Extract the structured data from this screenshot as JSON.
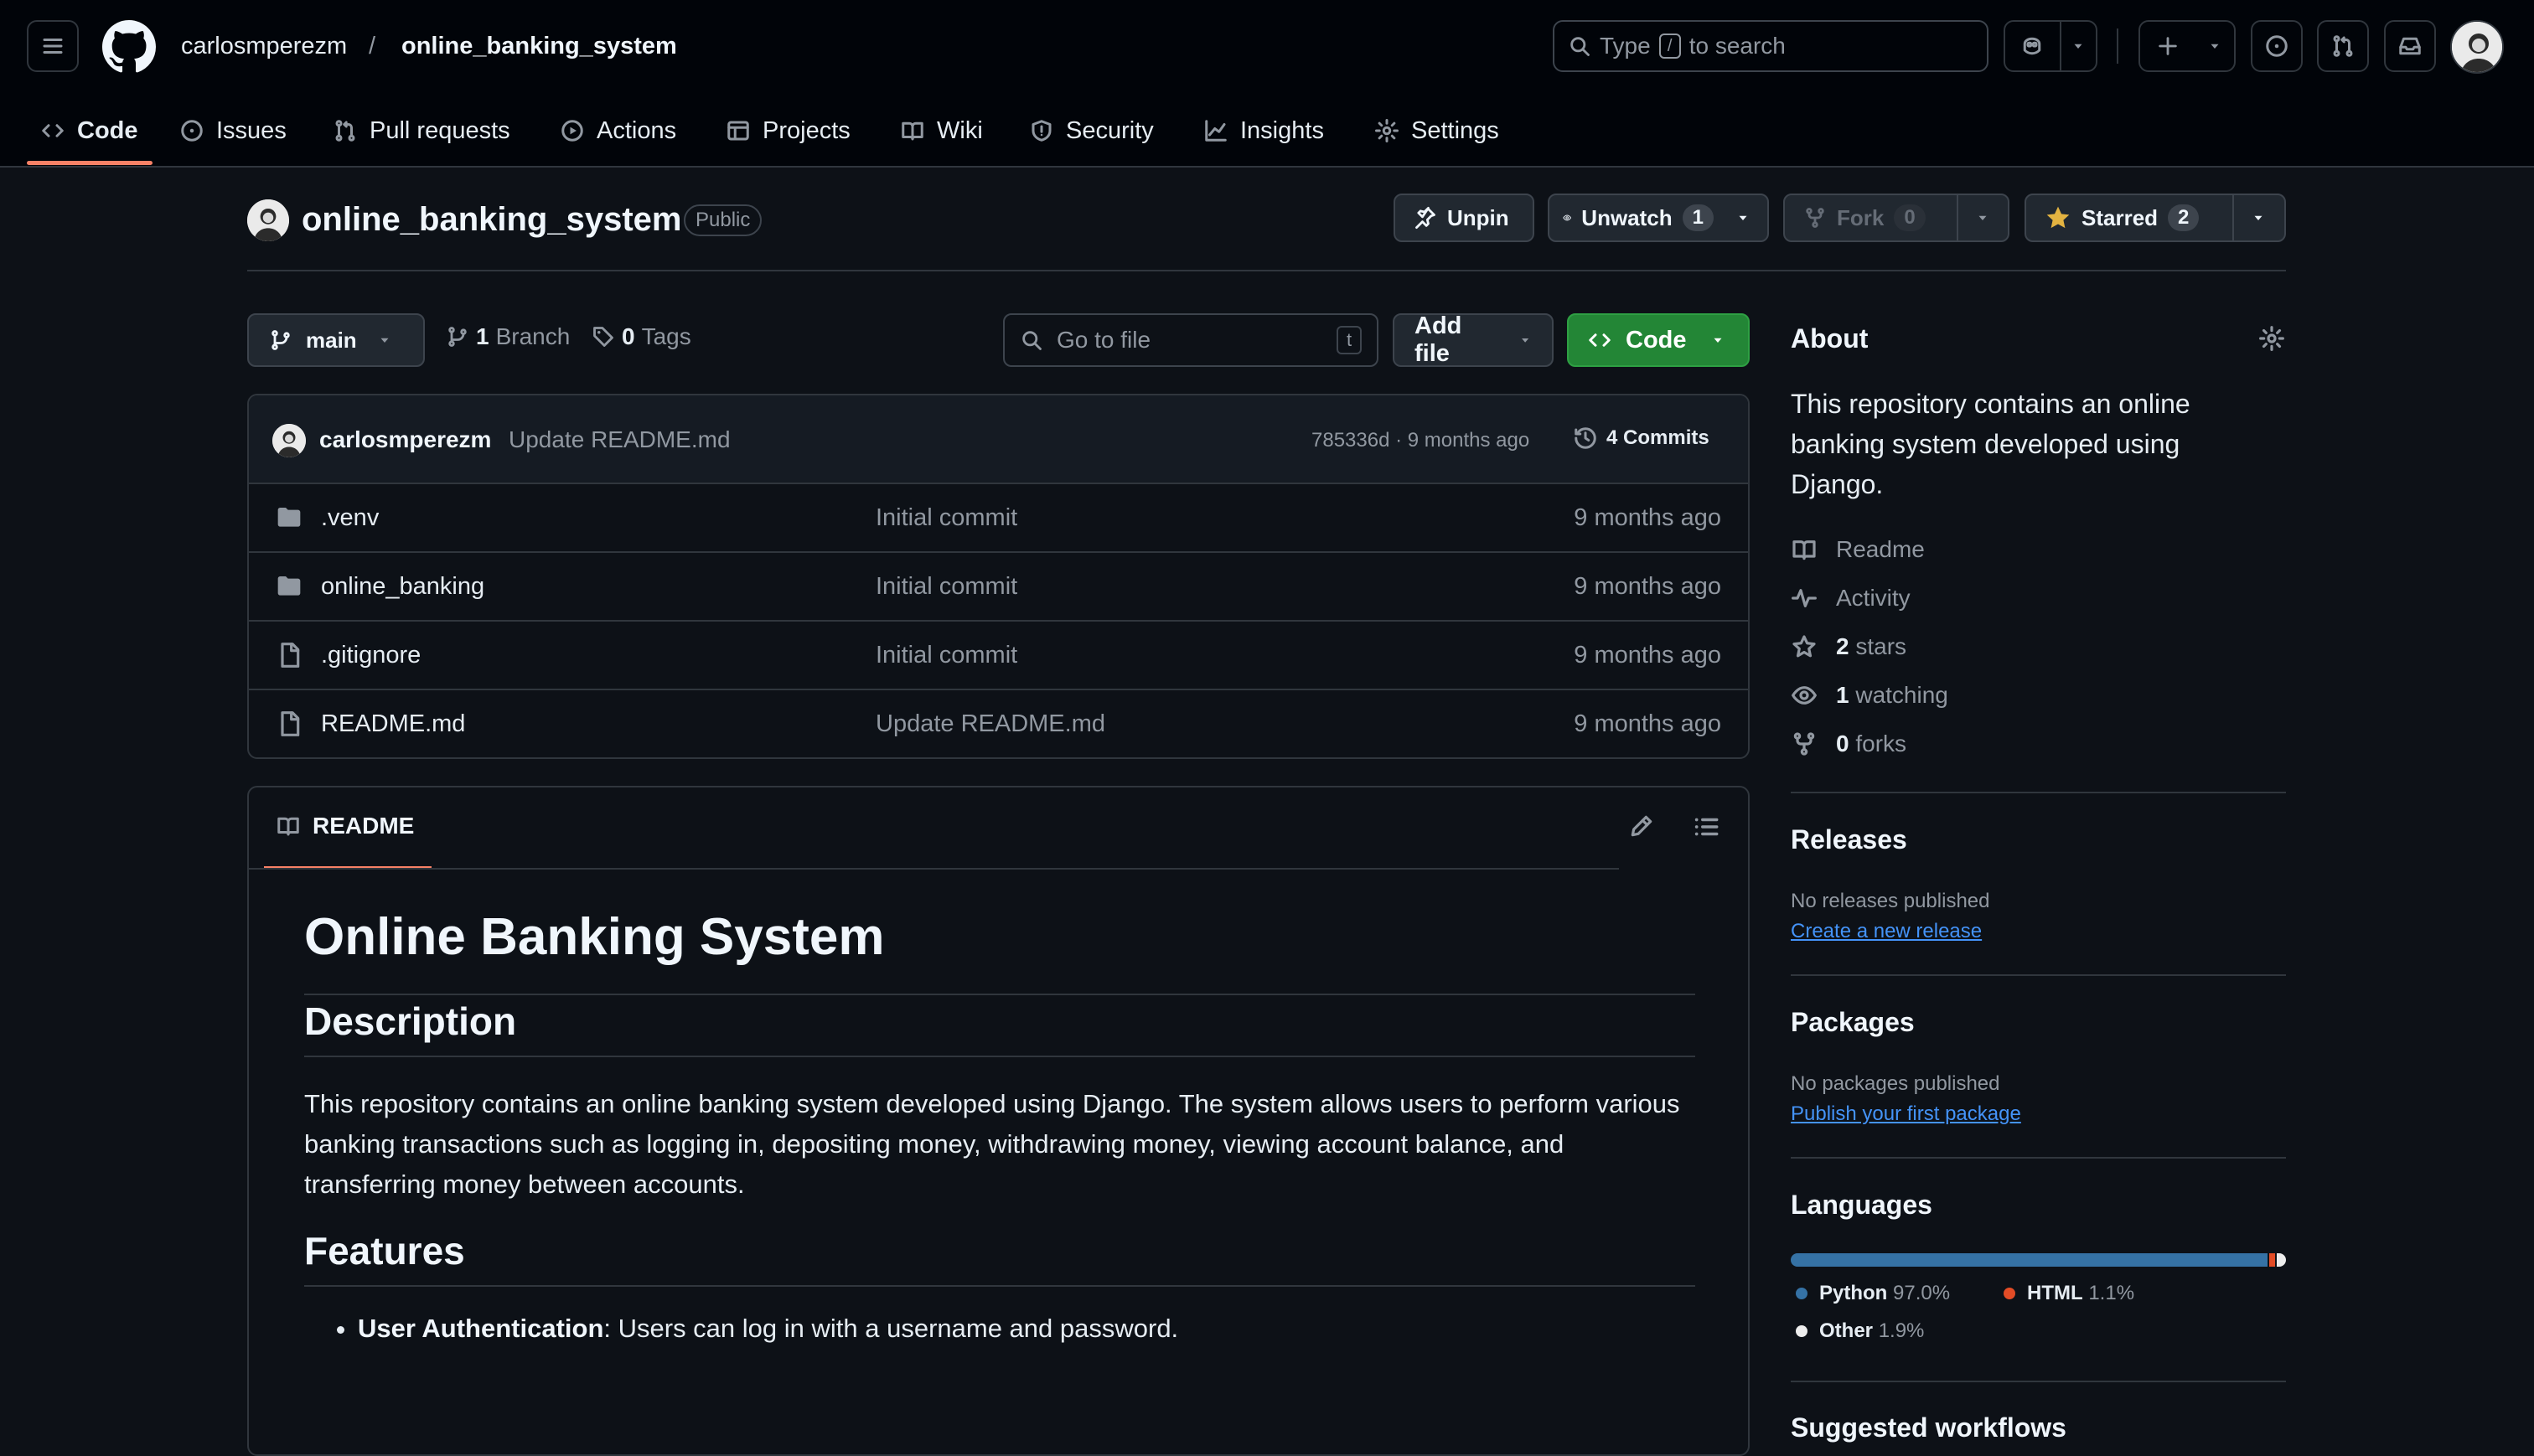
{
  "header": {
    "owner": "carlosmperezm",
    "separator": "/",
    "repo": "online_banking_system",
    "search_prefix": "Type",
    "search_key": "/",
    "search_suffix": "to search"
  },
  "tabs": [
    {
      "label": "Code"
    },
    {
      "label": "Issues"
    },
    {
      "label": "Pull requests"
    },
    {
      "label": "Actions"
    },
    {
      "label": "Projects"
    },
    {
      "label": "Wiki"
    },
    {
      "label": "Security"
    },
    {
      "label": "Insights"
    },
    {
      "label": "Settings"
    }
  ],
  "repo": {
    "name": "online_banking_system",
    "visibility": "Public",
    "unpin": "Unpin",
    "unwatch": "Unwatch",
    "watch_count": "1",
    "fork": "Fork",
    "fork_count": "0",
    "starred": "Starred",
    "star_count": "2"
  },
  "filenav": {
    "branch": "main",
    "branch_count": "1",
    "branch_label": "Branch",
    "tag_count": "0",
    "tag_label": "Tags",
    "goto_placeholder": "Go to file",
    "goto_key": "t",
    "add_file": "Add file",
    "code": "Code"
  },
  "latest_commit": {
    "author": "carlosmperezm",
    "message": "Update README.md",
    "meta": "785336d · 9 months ago",
    "commits": "4 Commits"
  },
  "files": [
    {
      "name": ".venv",
      "type": "folder",
      "message": "Initial commit",
      "date": "9 months ago"
    },
    {
      "name": "online_banking",
      "type": "folder",
      "message": "Initial commit",
      "date": "9 months ago"
    },
    {
      "name": ".gitignore",
      "type": "file",
      "message": "Initial commit",
      "date": "9 months ago"
    },
    {
      "name": "README.md",
      "type": "file",
      "message": "Update README.md",
      "date": "9 months ago"
    }
  ],
  "readme": {
    "tab": "README",
    "h1": "Online Banking System",
    "h2_description": "Description",
    "description": "This repository contains an online banking system developed using Django. The system allows users to perform various banking transactions such as logging in, depositing money, withdrawing money, viewing account balance, and transferring money between accounts.",
    "h2_features": "Features",
    "feature1_bold": "User Authentication",
    "feature1_text": ": Users can log in with a username and password."
  },
  "sidebar": {
    "about_title": "About",
    "about_desc": "This repository contains an online banking system developed using Django.",
    "readme": "Readme",
    "activity": "Activity",
    "stars_count": "2",
    "stars_label": "stars",
    "watching_count": "1",
    "watching_label": "watching",
    "forks_count": "0",
    "forks_label": "forks",
    "releases_title": "Releases",
    "releases_none": "No releases published",
    "releases_link": "Create a new release",
    "packages_title": "Packages",
    "packages_none": "No packages published",
    "packages_link": "Publish your first package",
    "languages_title": "Languages",
    "next_title": "Suggested workflows"
  },
  "languages": [
    {
      "name": "Python",
      "percent": "97.0%",
      "value": 97.0,
      "color": "#3572A5"
    },
    {
      "name": "HTML",
      "percent": "1.1%",
      "value": 1.1,
      "color": "#e34c26"
    },
    {
      "name": "Other",
      "percent": "1.9%",
      "value": 1.9,
      "color": "#ededed"
    }
  ],
  "colors": {
    "accent": "#f78166",
    "green": "#238636",
    "link": "#4493f8"
  }
}
